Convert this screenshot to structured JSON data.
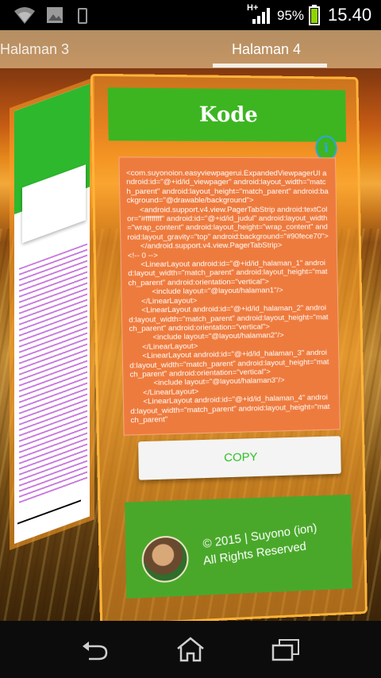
{
  "status_bar": {
    "network_type": "H+",
    "battery_percent": "95%",
    "time": "15.40",
    "icons": [
      "wifi-icon",
      "image-icon",
      "phone-icon",
      "signal-icon",
      "battery-icon"
    ]
  },
  "tabs": [
    {
      "label": "Halaman 3",
      "selected": false
    },
    {
      "label": "Halaman 4",
      "selected": true
    }
  ],
  "card": {
    "title": "Kode",
    "info_icon": "i",
    "code": "<com.suyonoion.easyviewpagerui.ExpandedViewpagerUI android:id=\"@+id/id_viewpager\" android:layout_width=\"match_parent\" android:layout_height=\"match_parent\" android:background=\"@drawable/background\">\n      <android.support.v4.view.PagerTabStrip android:textColor=\"#ffffffff\" android:id=\"@+id/id_judul\" android:layout_width=\"wrap_content\" android:layout_height=\"wrap_content\" android:layout_gravity=\"top\" android:background=\"#90fece70\">\n      </android.support.v4.view.PagerTabStrip>\n<!-- 0 -->\n      <LinearLayout android:id=\"@+id/id_halaman_1\" android:layout_width=\"match_parent\" android:layout_height=\"match_parent\" android:orientation=\"vertical\">\n           <include layout=\"@layout/halaman1\"/>\n      </LinearLayout>\n      <LinearLayout android:id=\"@+id/id_halaman_2\" android:layout_width=\"match_parent\" android:layout_height=\"match_parent\" android:orientation=\"vertical\">\n           <include layout=\"@layout/halaman2\"/>\n      </LinearLayout>\n      <LinearLayout android:id=\"@+id/id_halaman_3\" android:layout_width=\"match_parent\" android:layout_height=\"match_parent\" android:orientation=\"vertical\">\n           <include layout=\"@layout/halaman3\"/>\n      </LinearLayout>\n      <LinearLayout android:id=\"@+id/id_halaman_4\" android:layout_width=\"match_parent\" android:layout_height=\"match_parent\"",
    "copy_label": "COPY",
    "footer_line1": "© 2015 | Suyono (ion)",
    "footer_line2": "All Rights Reserved"
  },
  "colors": {
    "green": "#3cb521",
    "code_background": "#ee7b3e",
    "copy_text": "#2ebd22",
    "frame": "#ffb43a"
  },
  "nav": {
    "icons": [
      "back-icon",
      "home-icon",
      "recents-icon"
    ]
  }
}
